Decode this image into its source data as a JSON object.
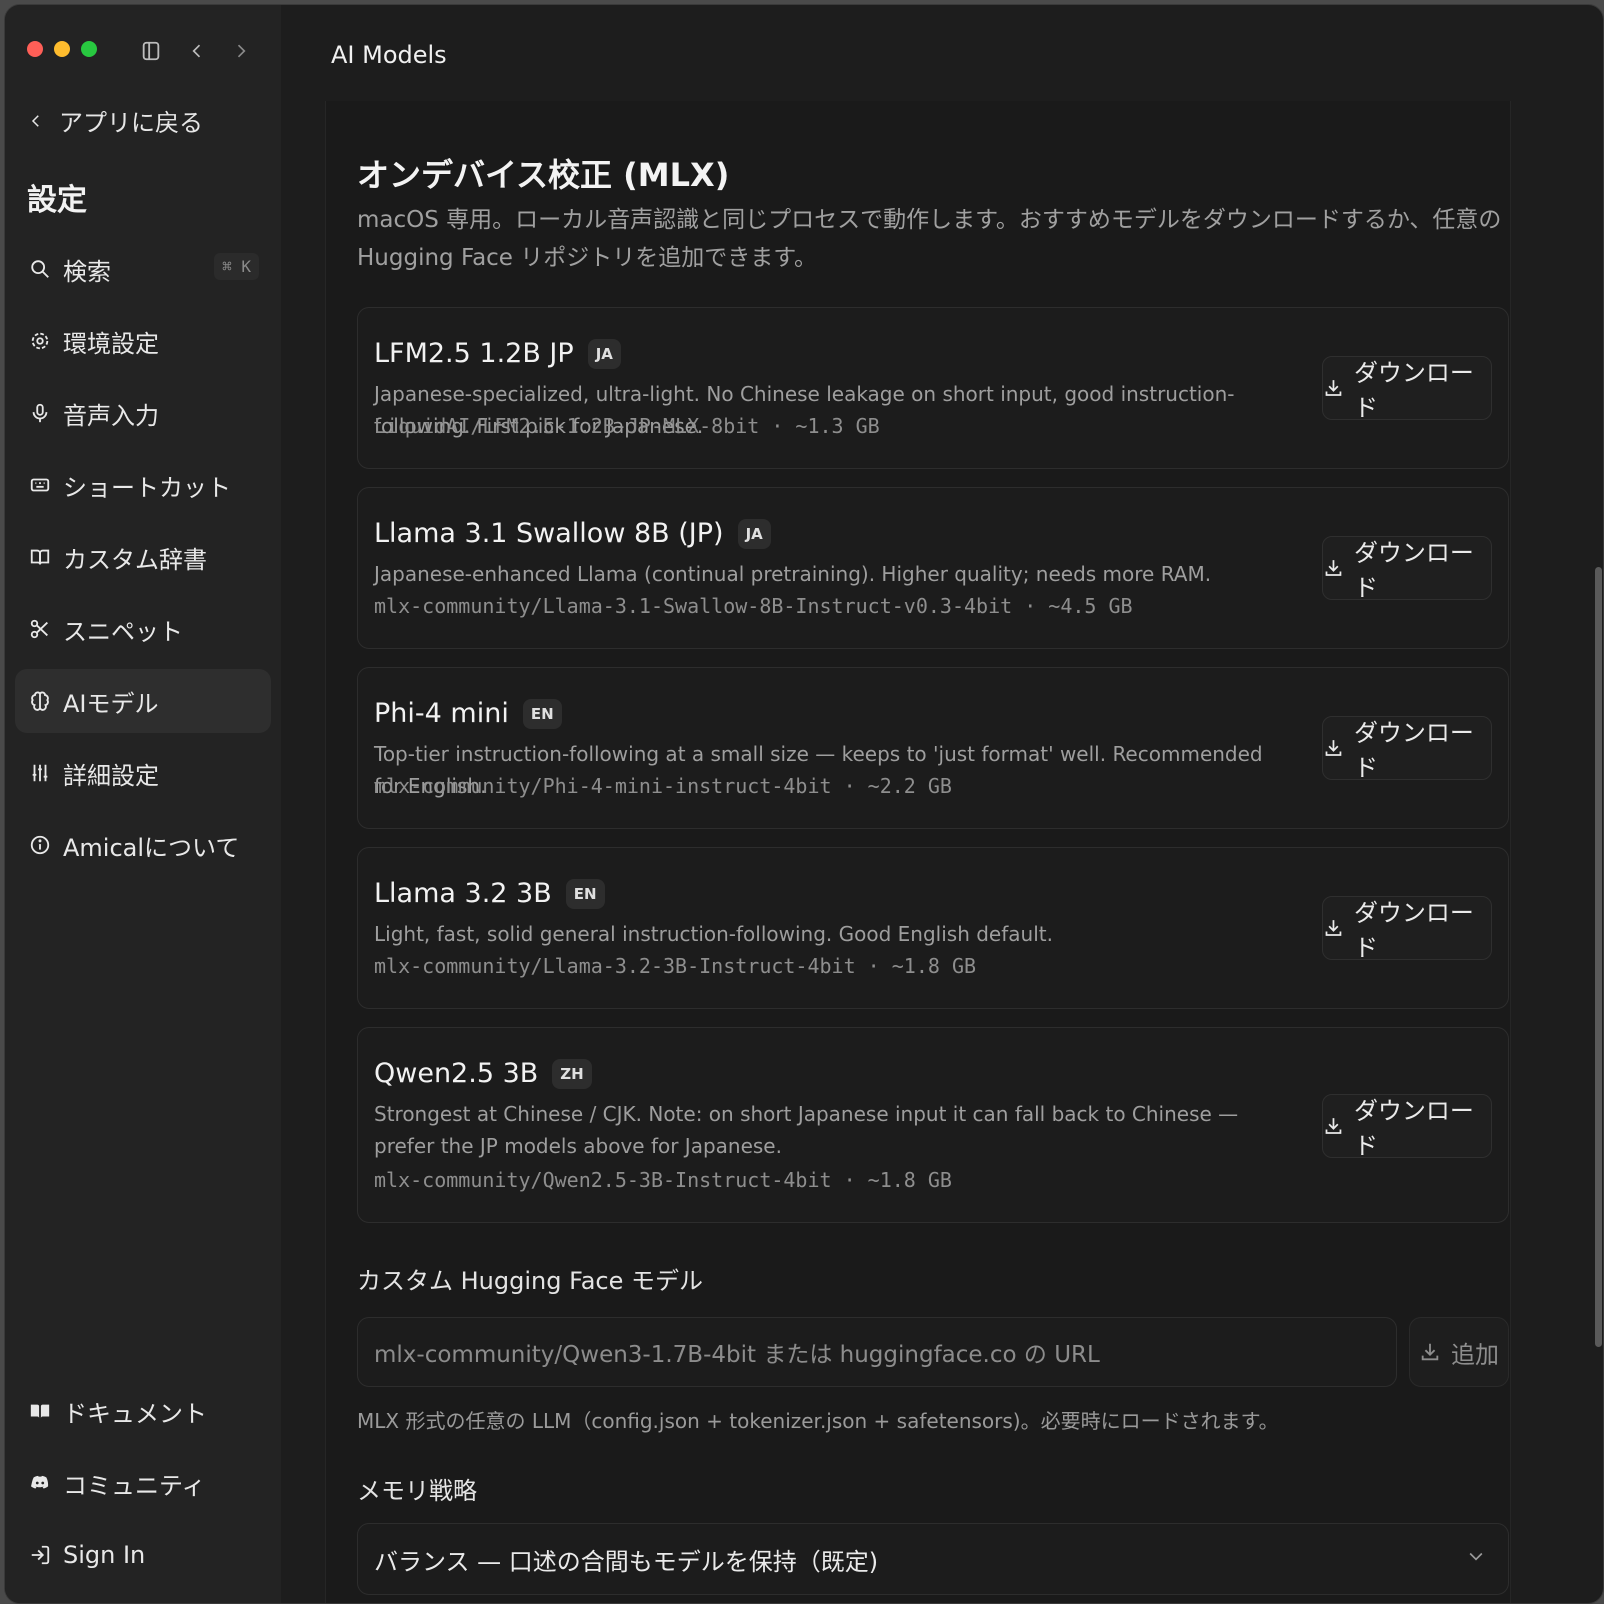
{
  "header": {
    "title": "AI Models"
  },
  "sidebar": {
    "back_label": "アプリに戻る",
    "title": "設定",
    "search_shortcut": "⌘ K",
    "items": [
      {
        "label": "検索",
        "icon": "search-icon"
      },
      {
        "label": "環境設定",
        "icon": "gear-icon"
      },
      {
        "label": "音声入力",
        "icon": "microphone-icon"
      },
      {
        "label": "ショートカット",
        "icon": "keyboard-icon"
      },
      {
        "label": "カスタム辞書",
        "icon": "book-icon"
      },
      {
        "label": "スニペット",
        "icon": "scissors-icon"
      },
      {
        "label": "AIモデル",
        "icon": "brain-icon",
        "active": true
      },
      {
        "label": "詳細設定",
        "icon": "sliders-icon"
      },
      {
        "label": "Amicalについて",
        "icon": "info-icon"
      }
    ],
    "bottom_items": [
      {
        "label": "ドキュメント",
        "icon": "book-open-icon"
      },
      {
        "label": "コミュニティ",
        "icon": "discord-icon"
      },
      {
        "label": "Sign In",
        "icon": "sign-in-icon"
      }
    ]
  },
  "section": {
    "title": "オンデバイス校正 (MLX)",
    "description": "macOS 専用。ローカル音声認識と同じプロセスで動作します。おすすめモデルをダウンロードするか、任意の Hugging Face リポジトリを追加できます。"
  },
  "download_label": "ダウンロード",
  "models": [
    {
      "name": "LFM2.5 1.2B JP",
      "lang": "JA",
      "description": "Japanese-specialized, ultra-light. No Chinese leakage on short input, good instruction-following. First pick for Japanese.",
      "meta": "LiquidAI/LFM2.5-1.2B-JP-MLX-8bit · ~1.3 GB"
    },
    {
      "name": "Llama 3.1 Swallow 8B (JP)",
      "lang": "JA",
      "description": "Japanese-enhanced Llama (continual pretraining). Higher quality; needs more RAM.",
      "meta": "mlx-community/Llama-3.1-Swallow-8B-Instruct-v0.3-4bit · ~4.5 GB"
    },
    {
      "name": "Phi-4 mini",
      "lang": "EN",
      "description": "Top-tier instruction-following at a small size — keeps to 'just format' well. Recommended for English.",
      "meta": "mlx-community/Phi-4-mini-instruct-4bit · ~2.2 GB"
    },
    {
      "name": "Llama 3.2 3B",
      "lang": "EN",
      "description": "Light, fast, solid general instruction-following. Good English default.",
      "meta": "mlx-community/Llama-3.2-3B-Instruct-4bit · ~1.8 GB"
    },
    {
      "name": "Qwen2.5 3B",
      "lang": "ZH",
      "description": "Strongest at Chinese / CJK. Note: on short Japanese input it can fall back to Chinese — prefer the JP models above for Japanese.",
      "meta": "mlx-community/Qwen2.5-3B-Instruct-4bit · ~1.8 GB"
    }
  ],
  "custom": {
    "label": "カスタム Hugging Face モデル",
    "placeholder": "mlx-community/Qwen3-1.7B-4bit または huggingface.co の URL",
    "add_label": "追加",
    "hint": "MLX 形式の任意の LLM（config.json + tokenizer.json + safetensors)。必要時にロードされます。"
  },
  "memory": {
    "label": "メモリ戦略",
    "selected": "バランス — 口述の合間もモデルを保持（既定)"
  }
}
